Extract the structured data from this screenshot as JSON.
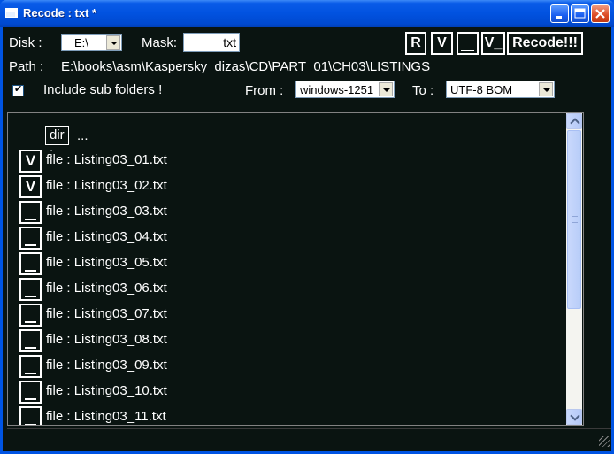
{
  "window": {
    "title": "Recode : txt *"
  },
  "toolbar": {
    "disk_label": "Disk :",
    "disk_value": "E:\\",
    "mask_label": "Mask:",
    "mask_value": "txt",
    "path_label": "Path :",
    "path_value": "E:\\books\\asm\\Kaspersky_dizas\\CD\\PART_01\\CH03\\LISTINGS",
    "include_subfolders_label": "Include sub folders !",
    "include_subfolders_checked": true,
    "from_label": "From  :",
    "from_value": "windows-1251",
    "to_label": "To  :",
    "to_value": "UTF-8 BOM",
    "buttons": {
      "r": "R",
      "v": "V",
      "blank": "",
      "v_": "V_",
      "recode": "Recode!!!"
    }
  },
  "list": {
    "dir_tag": "dir :",
    "dir_name": "...",
    "items": [
      {
        "mark": "V",
        "checked": true,
        "prefix": "file :",
        "name": "Listing03_01.txt"
      },
      {
        "mark": "V",
        "checked": true,
        "prefix": "file :",
        "name": "Listing03_02.txt"
      },
      {
        "mark": "",
        "checked": false,
        "prefix": "file :",
        "name": "Listing03_03.txt"
      },
      {
        "mark": "",
        "checked": false,
        "prefix": "file :",
        "name": "Listing03_04.txt"
      },
      {
        "mark": "",
        "checked": false,
        "prefix": "file :",
        "name": "Listing03_05.txt"
      },
      {
        "mark": "",
        "checked": false,
        "prefix": "file :",
        "name": "Listing03_06.txt"
      },
      {
        "mark": "",
        "checked": false,
        "prefix": "file :",
        "name": "Listing03_07.txt"
      },
      {
        "mark": "",
        "checked": false,
        "prefix": "file :",
        "name": "Listing03_08.txt"
      },
      {
        "mark": "",
        "checked": false,
        "prefix": "file :",
        "name": "Listing03_09.txt"
      },
      {
        "mark": "",
        "checked": false,
        "prefix": "file :",
        "name": "Listing03_10.txt"
      },
      {
        "mark": "",
        "checked": false,
        "prefix": "file :",
        "name": "Listing03_11.txt"
      }
    ]
  },
  "colors": {
    "background": "#0a1411",
    "titlebar": "#0054e3",
    "text": "#ffffff"
  }
}
